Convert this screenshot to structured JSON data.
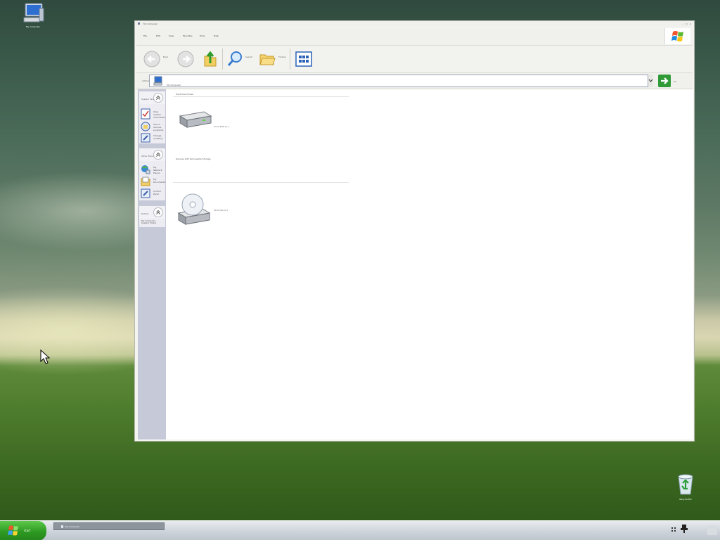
{
  "desktop": {
    "icons": [
      {
        "label": "My Computer"
      },
      {
        "label": "Recycle Bin"
      }
    ]
  },
  "window": {
    "title": "My Computer",
    "controls": "_ □ ×",
    "menu": [
      "File",
      "Edit",
      "View",
      "Favorites",
      "Tools",
      "Help"
    ],
    "toolbar": {
      "back_label": "Back",
      "forward_label": "",
      "search_label": "Search",
      "folders_label": "Folders"
    },
    "address": {
      "label": "Address",
      "value": "My Computer",
      "go_label": "Go"
    },
    "taskpane": {
      "sections": [
        {
          "title": "System Tasks",
          "items": [
            {
              "label": "View system information"
            },
            {
              "label": "Add or remove programs"
            },
            {
              "label": "Change a setting"
            }
          ]
        },
        {
          "title": "Other Places",
          "items": [
            {
              "label": "My Network Places"
            },
            {
              "label": "My Documents"
            },
            {
              "label": "Control Panel"
            }
          ]
        },
        {
          "title": "Details",
          "items": [
            {
              "label": "My Computer System Folder"
            }
          ]
        }
      ]
    },
    "groups": [
      {
        "title": "Hard Disk Drives",
        "items": [
          {
            "label": "Local Disk (C:)"
          }
        ]
      },
      {
        "title": "Devices with Removable Storage",
        "items": [
          {
            "label": "CD Drive (D:)"
          }
        ]
      }
    ]
  },
  "taskbar": {
    "start_label": "start",
    "task_label": "My Computer"
  }
}
